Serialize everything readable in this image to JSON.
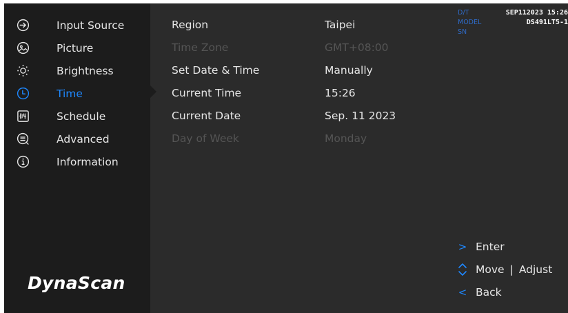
{
  "sidebar": {
    "items": [
      {
        "label": "Input Source",
        "icon": "input-source-icon",
        "active": false
      },
      {
        "label": "Picture",
        "icon": "picture-icon",
        "active": false
      },
      {
        "label": "Brightness",
        "icon": "brightness-icon",
        "active": false
      },
      {
        "label": "Time",
        "icon": "clock-icon",
        "active": true
      },
      {
        "label": "Schedule",
        "icon": "schedule-icon",
        "active": false
      },
      {
        "label": "Advanced",
        "icon": "advanced-icon",
        "active": false
      },
      {
        "label": "Information",
        "icon": "info-icon",
        "active": false
      }
    ],
    "logo": "DynaScan"
  },
  "settings": [
    {
      "label": "Region",
      "value": "Taipei",
      "enabled": true
    },
    {
      "label": "Time Zone",
      "value": "GMT+08:00",
      "enabled": false
    },
    {
      "label": "Set Date & Time",
      "value": "Manually",
      "enabled": true
    },
    {
      "label": "Current Time",
      "value": "15:26",
      "enabled": true
    },
    {
      "label": "Current Date",
      "value": "Sep. 11 2023",
      "enabled": true
    },
    {
      "label": "Day of Week",
      "value": "Monday",
      "enabled": false
    }
  ],
  "info": {
    "dt_label": "D/T",
    "dt_value": "SEP112023 15:26",
    "model_label": "MODEL",
    "model_value": "DS491LT5-1",
    "sn_label": "SN",
    "sn_value": ""
  },
  "help": {
    "enter_label": "Enter",
    "move_label": "Move",
    "separator": "|",
    "adjust_label": "Adjust",
    "back_label": "Back"
  },
  "colors": {
    "accent": "#1e88ff",
    "background": "#2b2b2b",
    "sidebar": "#1c1c1c",
    "text": "#e6e6e6",
    "disabled_text": "#555555",
    "info_label": "#2e6bc9"
  }
}
